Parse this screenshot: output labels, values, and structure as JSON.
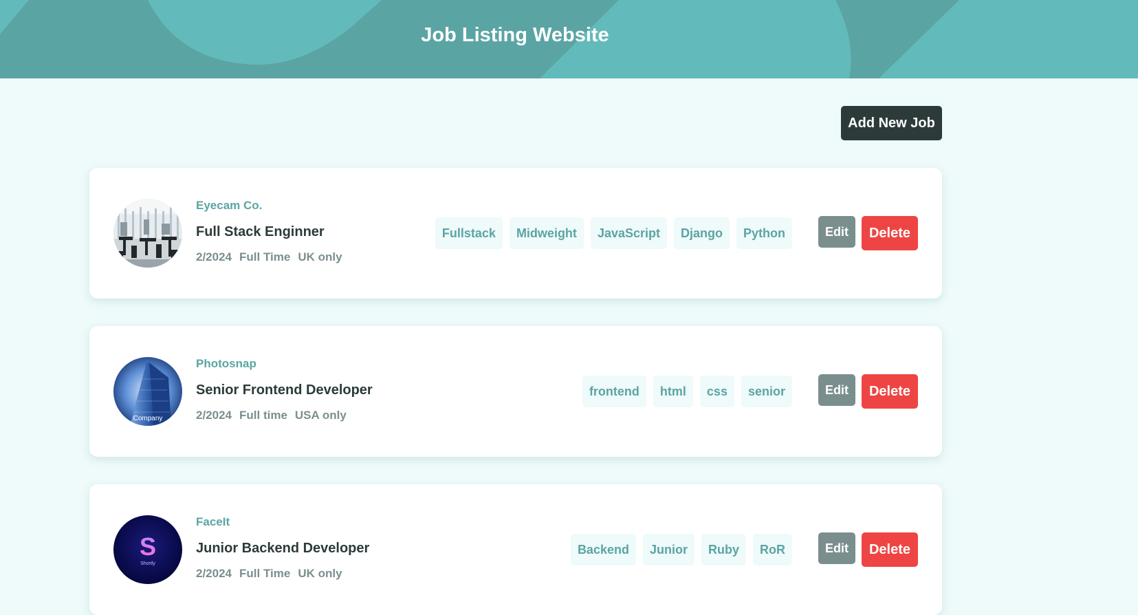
{
  "header": {
    "title": "Job Listing Website"
  },
  "actions": {
    "add_job_label": "Add New Job"
  },
  "jobs": [
    {
      "company": "Eyecam Co.",
      "position": "Full Stack Enginner",
      "posted": "2/2024",
      "contract": "Full Time",
      "location": "UK only",
      "tags": [
        "Fullstack",
        "Midweight",
        "JavaScript",
        "Django",
        "Python"
      ],
      "logo_icon": "office-photo-icon",
      "edit_label": "Edit",
      "delete_label": "Delete"
    },
    {
      "company": "Photosnap",
      "position": "Senior Frontend Developer",
      "posted": "2/2024",
      "contract": "Full time",
      "location": "USA only",
      "tags": [
        "frontend",
        "html",
        "css",
        "senior"
      ],
      "logo_icon": "building-photo-icon",
      "logo_caption": "Company",
      "edit_label": "Edit",
      "delete_label": "Delete"
    },
    {
      "company": "FaceIt",
      "position": "Junior Backend Developer",
      "posted": "2/2024",
      "contract": "Full Time",
      "location": "UK only",
      "tags": [
        "Backend",
        "Junior",
        "Ruby",
        "RoR"
      ],
      "logo_icon": "shortly-logo-icon",
      "logo_letter": "S",
      "logo_caption": "Shortly",
      "edit_label": "Edit",
      "delete_label": "Delete"
    }
  ],
  "colors": {
    "primary": "#5ba4a4",
    "background": "#effafa",
    "dark": "#2c3a3a",
    "gray": "#7b8e8e",
    "danger": "#ef4444"
  }
}
